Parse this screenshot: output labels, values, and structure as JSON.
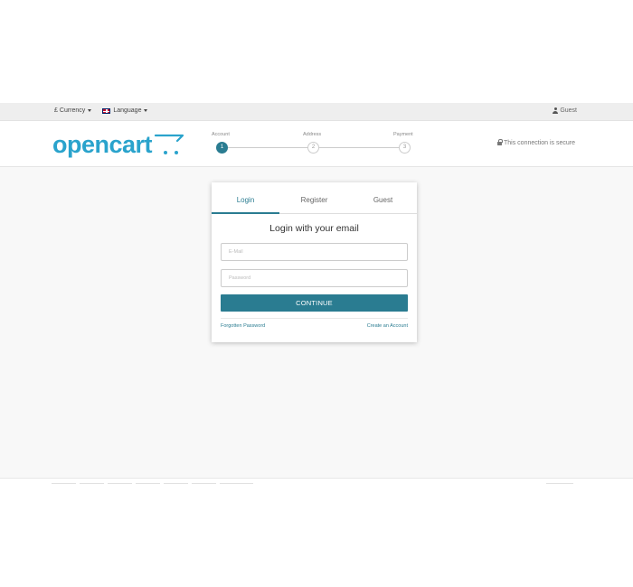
{
  "topbar": {
    "currency_symbol": "£",
    "currency_label": "Currency",
    "language_label": "Language",
    "user_label": "Guest"
  },
  "header": {
    "logo_text": "opencart",
    "secure_text": "This connection is secure",
    "steps": [
      {
        "label": "Account",
        "number": "1",
        "state": "active"
      },
      {
        "label": "Address",
        "number": "2",
        "state": "pending"
      },
      {
        "label": "Payment",
        "number": "3",
        "state": "pending"
      }
    ]
  },
  "login": {
    "tabs": [
      {
        "label": "Login",
        "active": true
      },
      {
        "label": "Register",
        "active": false
      },
      {
        "label": "Guest",
        "active": false
      }
    ],
    "title": "Login with your email",
    "email_placeholder": "E-Mail",
    "password_placeholder": "Password",
    "continue_label": "CONTINUE",
    "forgotten_label": "Forgotten Password",
    "create_label": "Create an Account"
  },
  "colors": {
    "accent": "#2a7c91",
    "logo": "#2aa3cc",
    "topbar_bg": "#eeeeee",
    "main_bg": "#f8f8f8"
  }
}
